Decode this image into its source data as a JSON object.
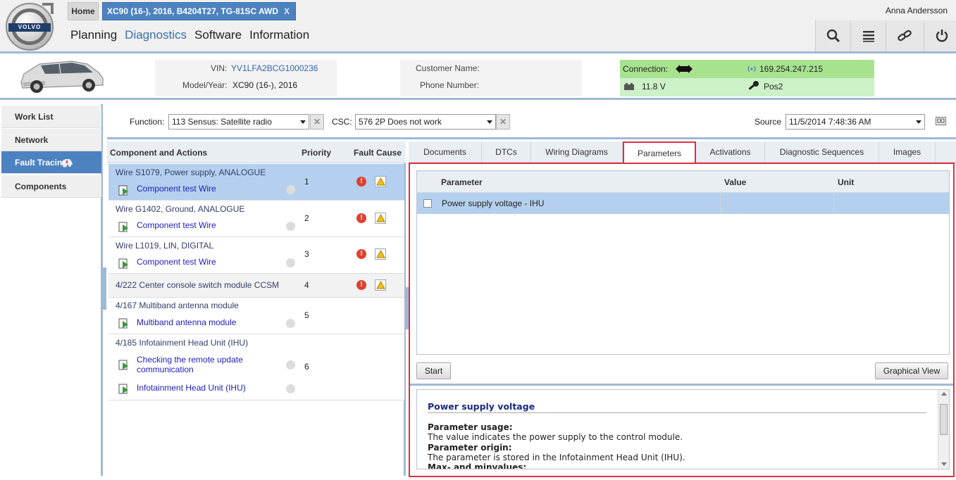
{
  "header": {
    "brand": "VOLVO",
    "tabs": {
      "home": "Home",
      "vehicle": "XC90 (16-), 2016, B4204T27, TG-81SC AWD",
      "close": "X"
    },
    "nav": [
      "Planning",
      "Diagnostics",
      "Software",
      "Information"
    ],
    "active_nav": "Diagnostics",
    "user": "Anna Andersson",
    "tools": [
      "search-icon",
      "list-icon",
      "link-icon",
      "power-icon"
    ]
  },
  "vehicle": {
    "vin_label": "VIN:",
    "vin": "YV1LFA2BCG1000236",
    "model_label": "Model/Year:",
    "model": "XC90 (16-), 2016",
    "customer_label": "Customer Name:",
    "customer": "",
    "phone_label": "Phone Number:",
    "phone": "",
    "connection_label": "Connection:",
    "ip": "169.254.247.215",
    "voltage": "11.8 V",
    "ignition": "Pos2"
  },
  "sidebar": {
    "items": [
      "Work List",
      "Network",
      "Fault Tracing",
      "Components"
    ],
    "active": "Fault Tracing"
  },
  "function_bar": {
    "function_label": "Function:",
    "function_value": "113 Sensus: Satellite radio",
    "csc_label": "CSC:",
    "csc_value": "576 2P Does not work",
    "source_label": "Source",
    "source_value": "11/5/2014 7:48:36 AM"
  },
  "components": {
    "columns": [
      "Component and Actions",
      "Priority",
      "Fault Cause"
    ],
    "rows": [
      {
        "name": "Wire S1079, Power supply, ANALOGUE",
        "actions": [
          "Component test Wire"
        ],
        "priority": "1"
      },
      {
        "name": "Wire G1402, Ground, ANALOGUE",
        "actions": [
          "Component test Wire"
        ],
        "priority": "2"
      },
      {
        "name": "Wire L1019, LIN, DIGITAL",
        "actions": [
          "Component test Wire"
        ],
        "priority": "3"
      },
      {
        "name": "4/222 Center console switch module CCSM",
        "actions": [],
        "priority": "4"
      },
      {
        "name": "4/167 Multiband antenna module",
        "actions": [
          "Multiband antenna module"
        ],
        "priority": "5"
      },
      {
        "name": "4/185 Infotainment Head Unit (IHU)",
        "actions": [
          "Checking the remote update",
          "communication",
          "Infotainment Head Unit (IHU)"
        ],
        "priority": "6"
      }
    ],
    "error_glyph": "!"
  },
  "tabs": [
    "Documents",
    "DTCs",
    "Wiring Diagrams",
    "Parameters",
    "Activations",
    "Diagnostic Sequences",
    "Images"
  ],
  "active_tab": "Parameters",
  "parameters": {
    "columns": [
      "Parameter",
      "Value",
      "Unit"
    ],
    "rows": [
      {
        "name": "Power supply voltage - IHU",
        "value": "",
        "unit": ""
      }
    ],
    "start_button": "Start",
    "graphical_view_button": "Graphical View"
  },
  "description": {
    "title": "Power supply voltage",
    "usage_label": "Parameter usage:",
    "usage_text": "The value indicates the power supply to the control module.",
    "origin_label": "Parameter origin:",
    "origin_text": "The parameter is stored in the Infotainment Head Unit (IHU).",
    "minmax_label": "Max- and minvalues:"
  },
  "colors": {
    "accent": "#4d82c0",
    "selected_row": "#b4d0ee",
    "highlight_border": "#e03040",
    "connection_ok": "#a7e28f",
    "error": "#e04030",
    "link": "#2020c0"
  }
}
